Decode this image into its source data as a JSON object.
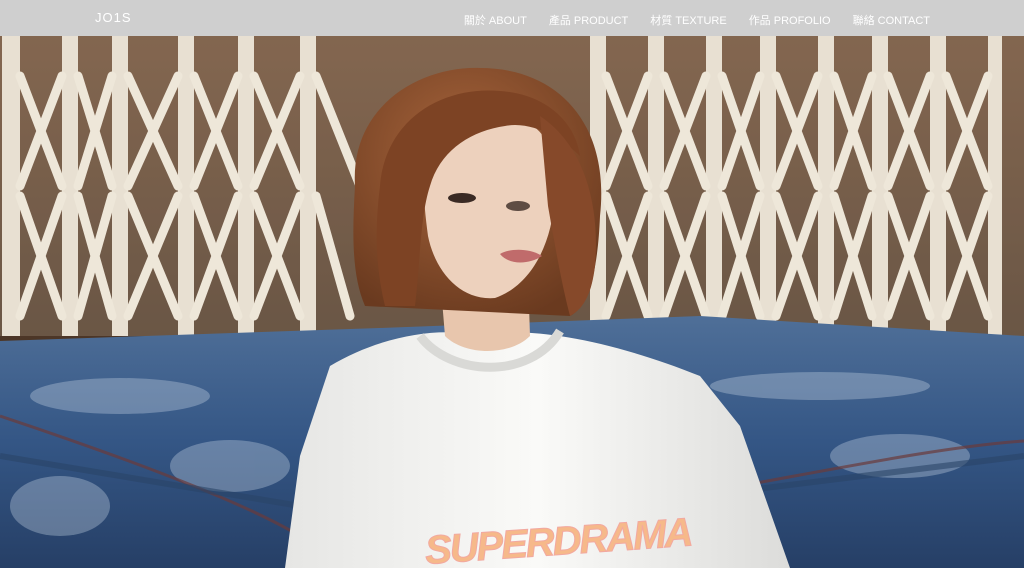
{
  "brand": {
    "name": "JO1S"
  },
  "nav": {
    "items": [
      {
        "label": "關於 ABOUT"
      },
      {
        "label": "產品 PRODUCT"
      },
      {
        "label": "材質 TEXTURE"
      },
      {
        "label": "作品 PROFOLIO"
      },
      {
        "label": "聯絡 CONTACT"
      }
    ]
  },
  "hero": {
    "shirt_print": "SUPERDRAMA"
  },
  "colors": {
    "navbar_bg": "#cfcfcf",
    "nav_text": "#ffffff",
    "gate": "#e8e2d6",
    "gate_shadow": "#7a5a3c",
    "tarp_blue": "#3f5f8a",
    "hair": "#8a4a2a",
    "shirt": "#f4f4f2",
    "print": "#f6b98a"
  }
}
